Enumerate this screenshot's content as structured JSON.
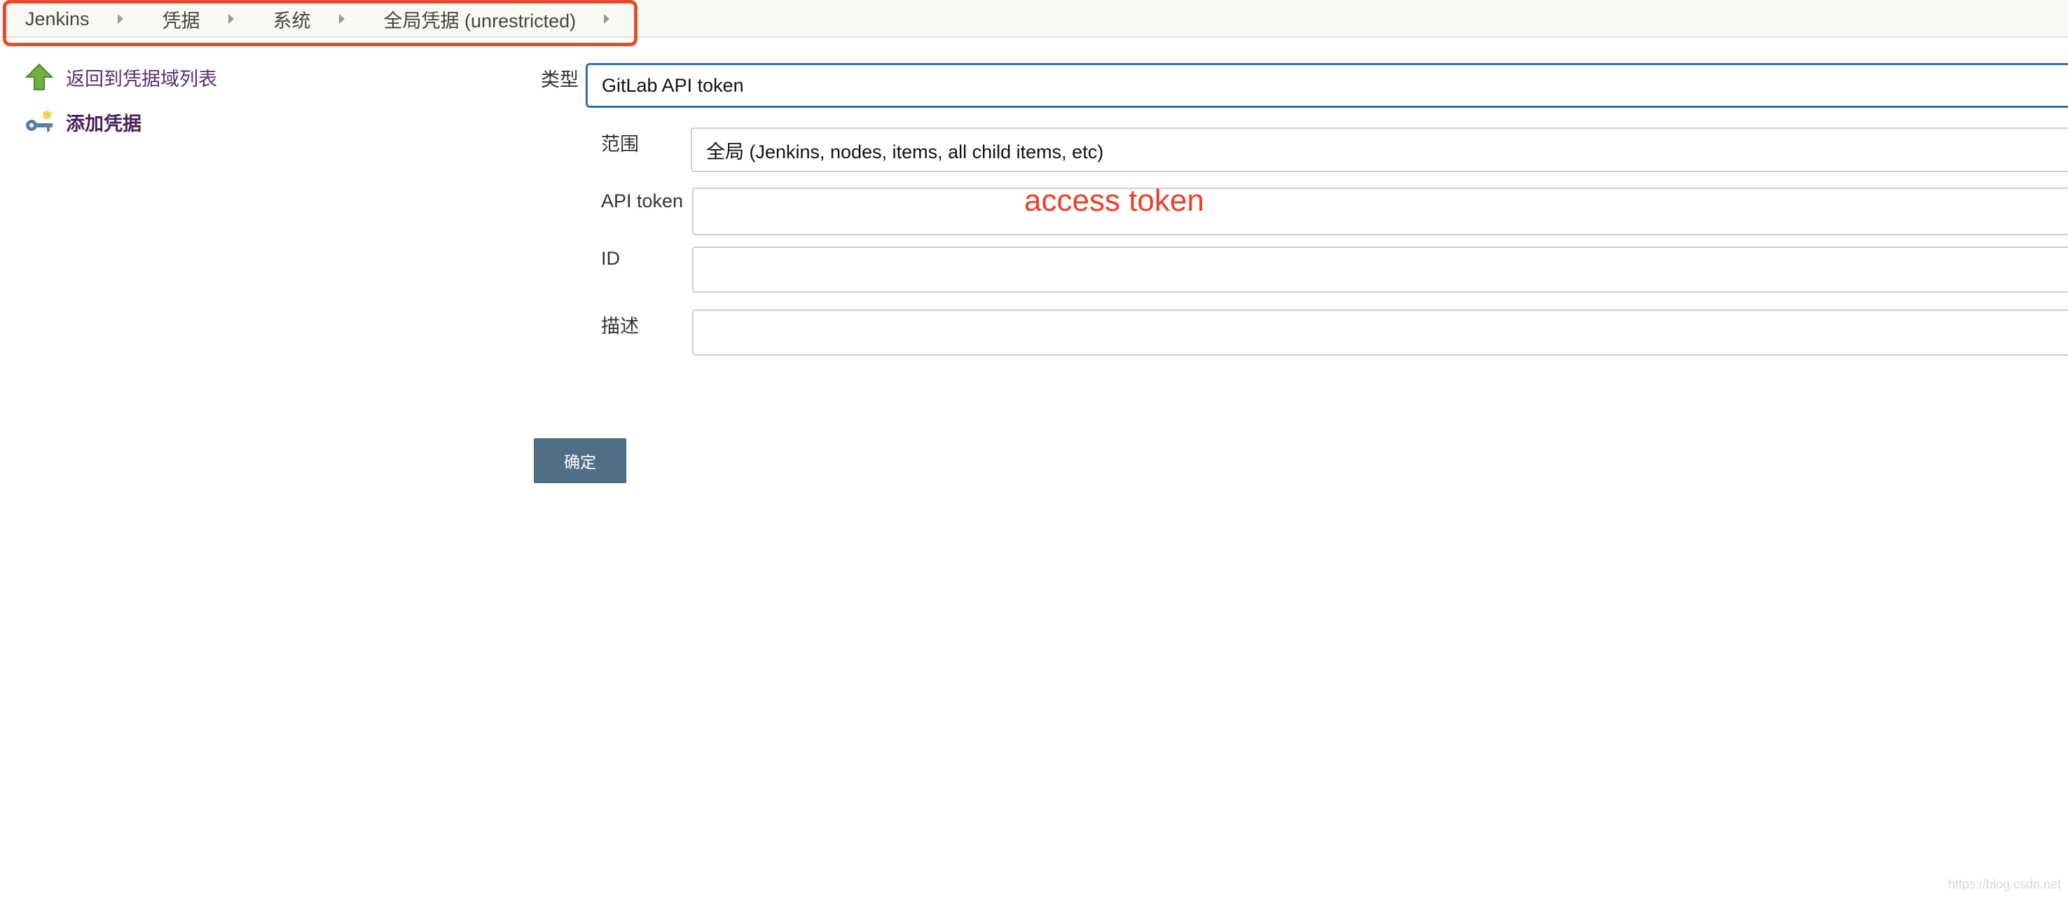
{
  "breadcrumb": {
    "items": [
      {
        "label": "Jenkins"
      },
      {
        "label": "凭据"
      },
      {
        "label": "系统"
      },
      {
        "label": "全局凭据 (unrestricted)"
      }
    ]
  },
  "sidebar": {
    "items": [
      {
        "label": "返回到凭据域列表",
        "icon": "up-arrow-icon"
      },
      {
        "label": "添加凭据",
        "icon": "key-icon"
      }
    ]
  },
  "form": {
    "kind": {
      "label": "类型",
      "value": "GitLab API token"
    },
    "scope": {
      "label": "范围",
      "value": "全局 (Jenkins, nodes, items, all child items, etc)"
    },
    "api_token": {
      "label": "API token",
      "value": ""
    },
    "id": {
      "label": "ID",
      "value": ""
    },
    "description": {
      "label": "描述",
      "value": ""
    },
    "annotation": "access token",
    "submit_label": "确定"
  },
  "colors": {
    "highlight": "#e84a2f",
    "annotation": "#e8412c",
    "button": "#4f6f89",
    "selected_border": "#2e6fba"
  }
}
